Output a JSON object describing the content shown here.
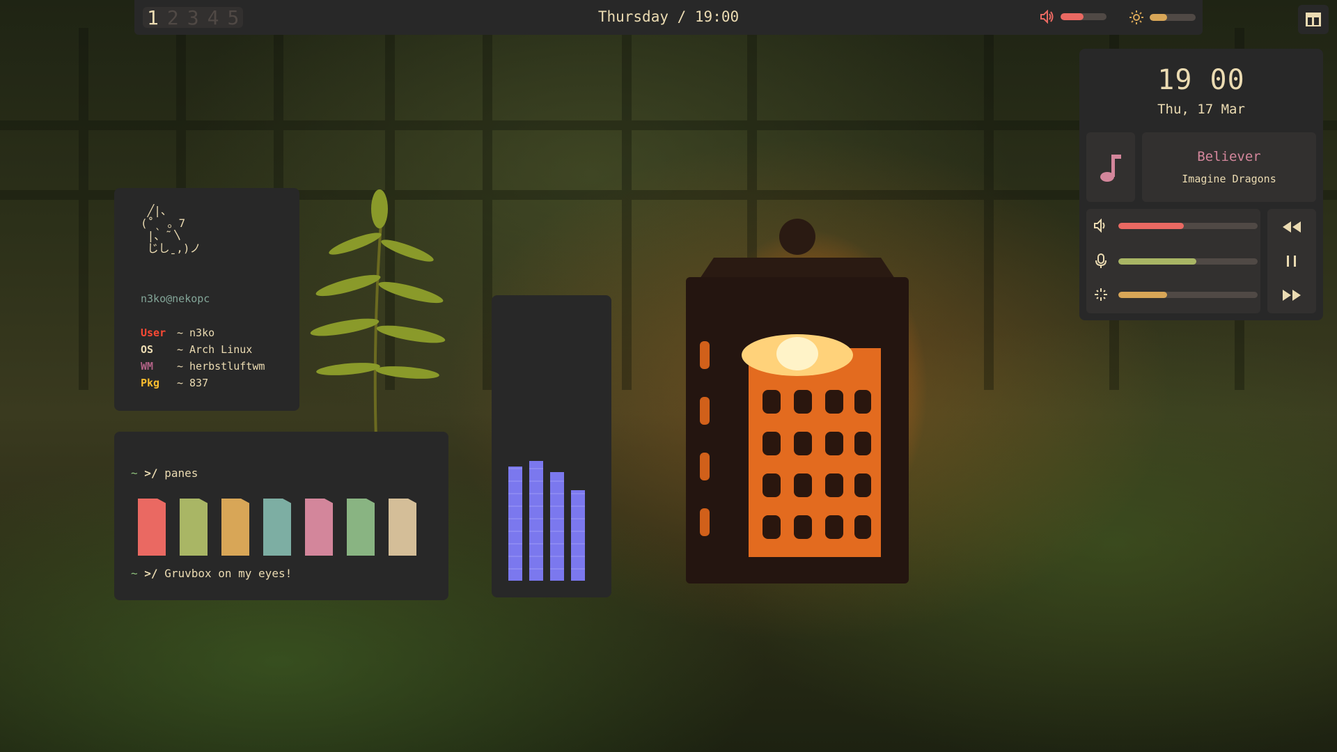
{
  "topbar": {
    "workspaces": [
      "1",
      "2",
      "3",
      "4",
      "5"
    ],
    "active_workspace": "1",
    "datetime": "Thursday / 19:00",
    "volume_level": 0.5,
    "brightness_level": 0.38
  },
  "fetch": {
    "ascii_art": " ╱|、\n(˚ˎ 。7\n |、˜〵\n じしˍ,)ノ",
    "host": "n3ko@nekopc",
    "rows": [
      {
        "key": "User",
        "sep": "~",
        "value": "n3ko",
        "color": "#fb4934"
      },
      {
        "key": "OS",
        "sep": "~",
        "value": "Arch Linux",
        "color": "#ebdbb2"
      },
      {
        "key": "WM",
        "sep": "~",
        "value": "herbstluftwm",
        "color": "#b16286"
      },
      {
        "key": "Pkg",
        "sep": "~",
        "value": "837",
        "color": "#fabd2f"
      }
    ]
  },
  "panes": {
    "prompt_tilde": "~",
    "prompt_arrow": ">/",
    "command": "panes",
    "footer": "Gruvbox on my eyes!",
    "colors": [
      "#ea6962",
      "#a9b665",
      "#d8a657",
      "#7daea3",
      "#d3869b",
      "#89b482",
      "#d4be98"
    ]
  },
  "visualizer": {
    "levels": [
      0.82,
      0.86,
      0.78,
      0.65
    ],
    "color": "#7b78ee"
  },
  "dashboard": {
    "time_hour": "19",
    "time_minute": "00",
    "date": "Thu, 17 Mar",
    "song_title": "Believer",
    "song_artist": "Imagine Dragons",
    "volume_level": 0.47,
    "mic_level": 0.56,
    "brightness_level": 0.35
  }
}
